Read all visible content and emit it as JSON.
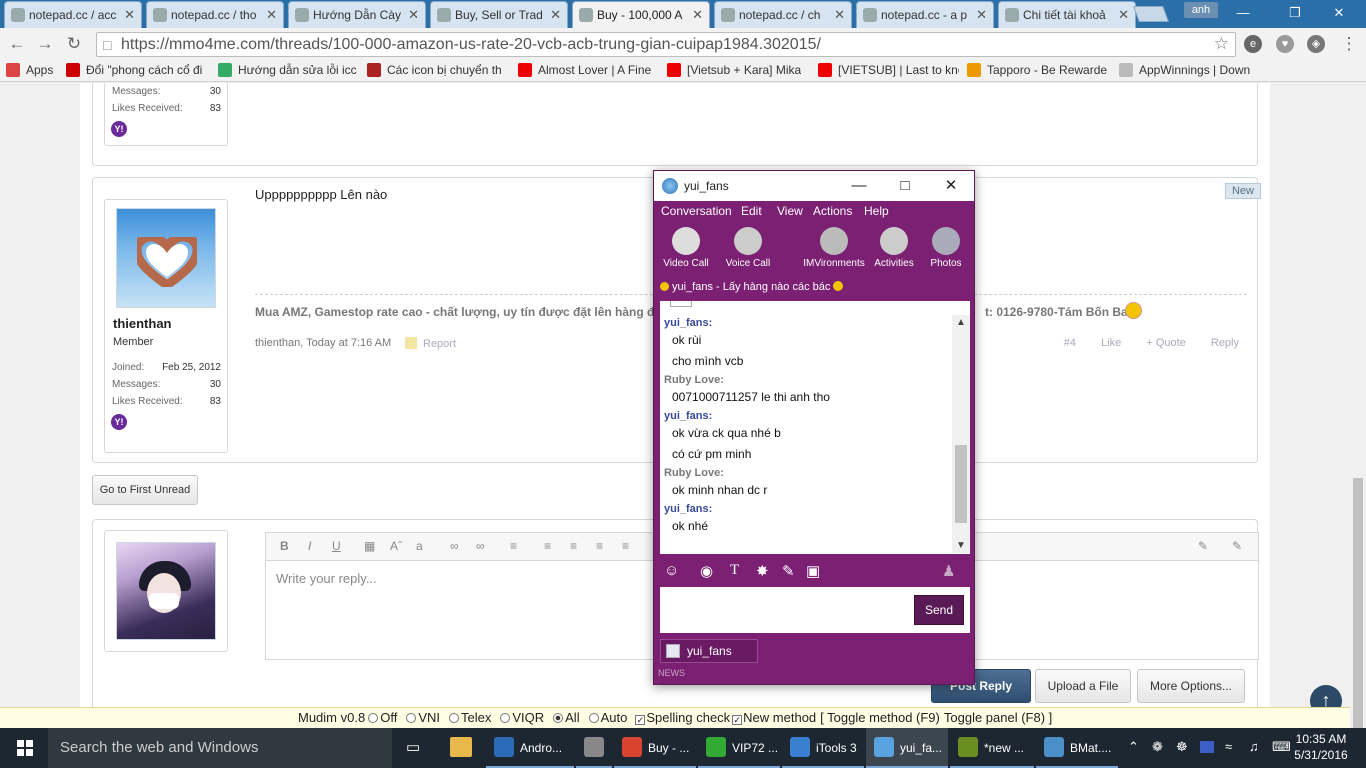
{
  "tabs": [
    {
      "label": "notepad.cc / acc",
      "active": false
    },
    {
      "label": "notepad.cc / tho",
      "active": false
    },
    {
      "label": "Hướng Dẫn Cày",
      "active": false
    },
    {
      "label": "Buy, Sell or Trad",
      "active": false
    },
    {
      "label": "Buy - 100,000 A",
      "active": true
    },
    {
      "label": "notepad.cc / ch",
      "active": false
    },
    {
      "label": "notepad.cc - a p",
      "active": false
    },
    {
      "label": "Chi tiết tài khoả",
      "active": false
    }
  ],
  "profile_label": "anh",
  "address": {
    "url": "https://mmo4me.com/threads/100-000-amazon-us-rate-20-vcb-acb-trung-gian-cuipap1984.302015/"
  },
  "bookmarks": [
    {
      "label": "Apps",
      "color": "#d44"
    },
    {
      "label": "Đổi \"phong cách cổ đi",
      "color": "#c00"
    },
    {
      "label": "Hướng dẫn sửa lỗi icc",
      "color": "#3a6"
    },
    {
      "label": "Các icon bị chuyển th",
      "color": "#a22"
    },
    {
      "label": "Almost Lover | A Fine",
      "color": "#e00"
    },
    {
      "label": "[Vietsub + Kara] Mika",
      "color": "#e00"
    },
    {
      "label": "[VIETSUB] | Last to kno",
      "color": "#e00"
    },
    {
      "label": "Tapporo - Be Rewarde",
      "color": "#e90"
    },
    {
      "label": "AppWinnings | Down",
      "color": "#bbb"
    }
  ],
  "prev_post": {
    "stats": [
      {
        "label": "Messages:",
        "value": "30"
      },
      {
        "label": "Likes Received:",
        "value": "83"
      }
    ]
  },
  "post": {
    "username": "thienthan",
    "user_title": "Member",
    "stats": [
      {
        "label": "Joined:",
        "value": "Feb 25, 2012"
      },
      {
        "label": "Messages:",
        "value": "30"
      },
      {
        "label": "Likes Received:",
        "value": "83"
      }
    ],
    "new_tag": "New",
    "message": "Upppppppppp Lên nào",
    "signature": "Mua AMZ, Gamestop rate cao - chất lượng, uy tín được đặt lên hàng đầ",
    "signature_tail": "t: 0126-9780-Tám Bốn Ba",
    "meta": "thienthan, Today at 7:16 AM",
    "report": "Report",
    "post_number": "#4",
    "like": "Like",
    "quote": "+ Quote",
    "reply": "Reply"
  },
  "go_first_unread": "Go to First Unread",
  "reply_box": {
    "placeholder": "Write your reply...",
    "post_reply": "Post Reply",
    "upload": "Upload a File",
    "more_options": "More Options..."
  },
  "mudim": {
    "version": "Mudim v0.8",
    "options": [
      "Off",
      "VNI",
      "Telex",
      "VIQR",
      "All",
      "Auto"
    ],
    "selected": "All",
    "spelling": "Spelling check",
    "new_method": "New method",
    "toggle_method": "[ Toggle method (F9)",
    "toggle_panel": "Toggle panel (F8) ]"
  },
  "taskbar": {
    "search": "Search the web and Windows",
    "items": [
      {
        "label": "Andro...",
        "color": "#2b6cb8"
      },
      {
        "label": "",
        "color": "#888"
      },
      {
        "label": "Buy - ...",
        "color": "#d8442f"
      },
      {
        "label": "VIP72 ...",
        "color": "#3a3"
      },
      {
        "label": "iTools 3",
        "color": "#3b7fd0"
      },
      {
        "label": "yui_fa...",
        "color": "#5aa3e0"
      },
      {
        "label": "*new ...",
        "color": "#6b8e23"
      },
      {
        "label": "BMat....",
        "color": "#4a8fc8"
      }
    ],
    "time": "10:35 AM",
    "date": "5/31/2016"
  },
  "im": {
    "title": "yui_fans",
    "menu": [
      "Conversation",
      "Edit",
      "View",
      "Actions",
      "Help"
    ],
    "tools": [
      {
        "label": "Video Call",
        "color": "#ddd"
      },
      {
        "label": "Voice Call",
        "color": "#ccc"
      },
      {
        "label": "IMVironments",
        "color": "#bbb"
      },
      {
        "label": "Activities",
        "color": "#ccc"
      },
      {
        "label": "Photos",
        "color": "#aab"
      }
    ],
    "status": "yui_fans  -  Lấy hàng nào các bác",
    "messages": [
      {
        "who": "yui_fans:",
        "side": "me",
        "lines": [
          "ok rùi",
          "cho mình vcb"
        ]
      },
      {
        "who": "Ruby Love:",
        "side": "them",
        "lines": [
          "0071000711257 le thi anh tho"
        ]
      },
      {
        "who": "yui_fans:",
        "side": "me",
        "lines": [
          "ok vừa ck qua nhé b",
          "có cứ pm minh"
        ]
      },
      {
        "who": "Ruby Love:",
        "side": "them",
        "lines": [
          "ok minh nhan dc r"
        ]
      },
      {
        "who": "yui_fans:",
        "side": "me",
        "lines": [
          "ok nhé"
        ]
      }
    ],
    "send": "Send",
    "tab": "yui_fans",
    "news": "NEWS"
  }
}
